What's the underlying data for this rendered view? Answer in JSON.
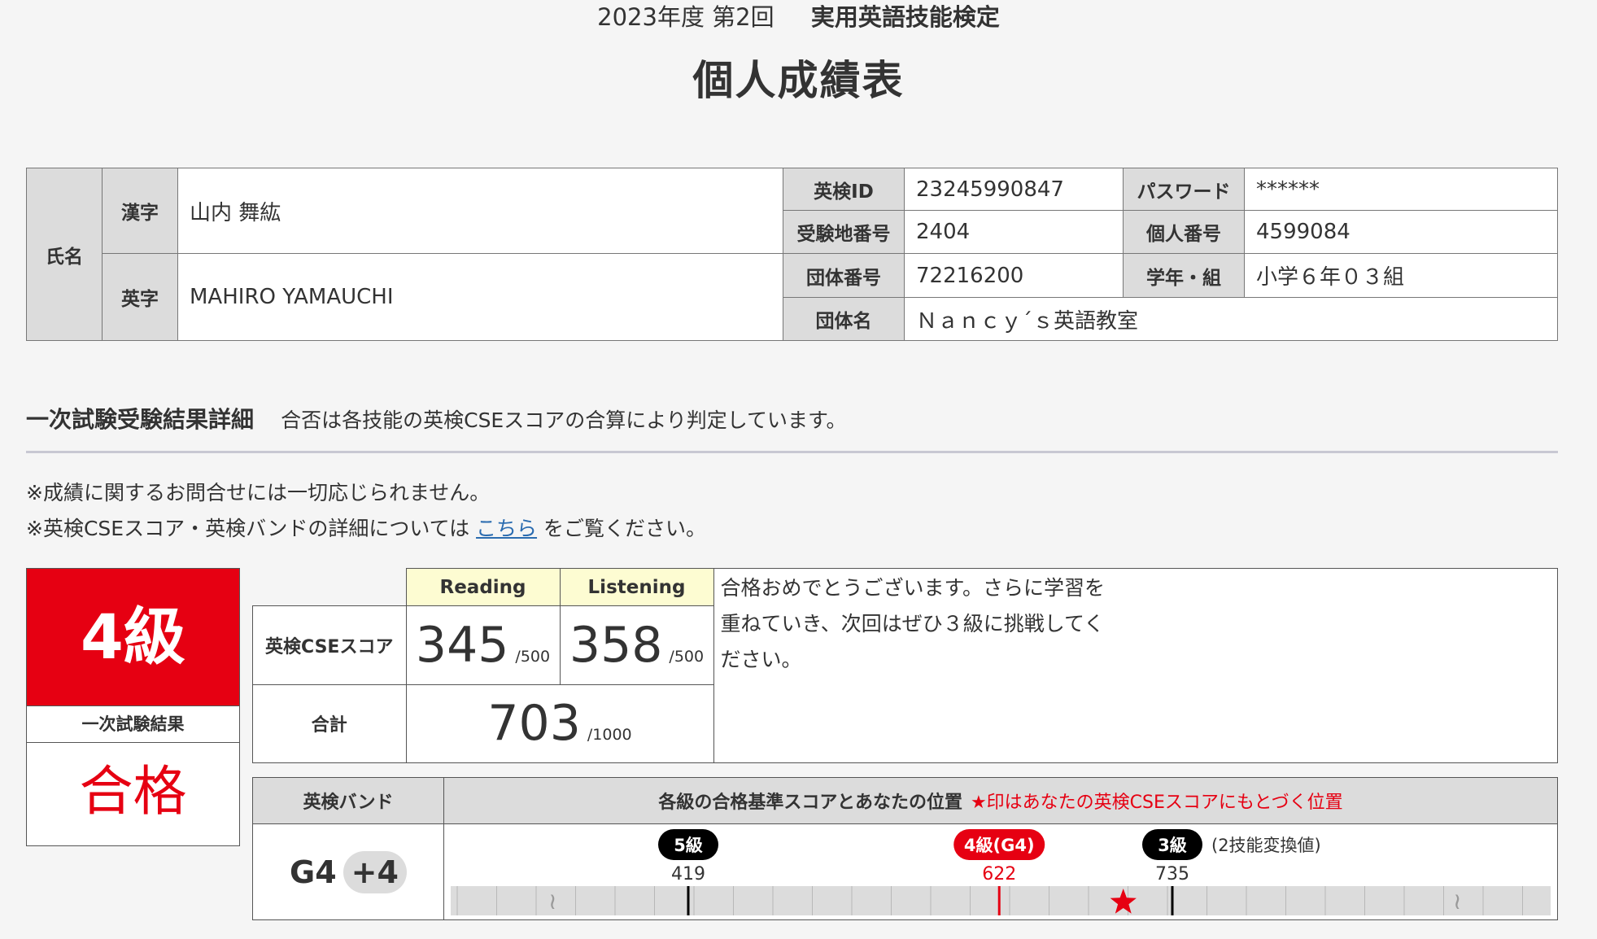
{
  "header": {
    "year_round": "2023年度 第2回",
    "exam_name": "実用英語技能検定",
    "title": "個人成績表"
  },
  "student": {
    "name_label": "氏名",
    "kanji_label": "漢字",
    "kanji_name": "山内 舞紘",
    "roman_label": "英字",
    "roman_name": "MAHIRO YAMAUCHI",
    "eiken_id_label": "英検ID",
    "eiken_id": "23245990847",
    "password_label": "パスワード",
    "password": "******",
    "exam_site_label": "受験地番号",
    "exam_site": "2404",
    "personal_no_label": "個人番号",
    "personal_no": "4599084",
    "group_no_label": "団体番号",
    "group_no": "72216200",
    "grade_class_label": "学年・組",
    "grade_class": "小学６年０３組",
    "group_name_label": "団体名",
    "group_name": "Ｎａｎｃｙ´ｓ英語教室"
  },
  "section": {
    "title": "一次試験受験結果詳細",
    "description": "合否は各技能の英検CSEスコアの合算により判定しています。",
    "note1": "※成績に関するお問合せには一切応じられません。",
    "note2_before": "※英検CSEスコア・英検バンドの詳細については",
    "note2_link": "こちら",
    "note2_after": "をご覧ください。"
  },
  "result": {
    "grade": "4級",
    "label": "一次試験結果",
    "outcome": "合格"
  },
  "scores": {
    "reading_label": "Reading",
    "listening_label": "Listening",
    "cse_label": "英検CSEスコア",
    "reading": "345",
    "reading_max": "/500",
    "listening": "358",
    "listening_max": "/500",
    "total_label": "合計",
    "total": "703",
    "total_max": "/1000",
    "message_line1": "合格おめでとうございます。さらに学習を",
    "message_line2": "重ねていき、次回はぜひ３級に挑戦してく",
    "message_line3": "ださい。"
  },
  "band": {
    "label": "英検バンド",
    "header": "各級の合格基準スコアとあなたの位置",
    "header_note": "★印はあなたの英検CSEスコアにもとづく位置",
    "value": "G4",
    "plus": "+4",
    "conversion_note": "(2技能変換値)",
    "markers": [
      {
        "name": "5級",
        "score": "419",
        "color": "#000000",
        "value": 419
      },
      {
        "name": "4級(G4)",
        "score": "622",
        "color": "#e60012",
        "value": 622
      },
      {
        "name": "3級",
        "score": "735",
        "color": "#000000",
        "value": 735
      }
    ],
    "your_score": 703,
    "star_color": "#e60012"
  }
}
